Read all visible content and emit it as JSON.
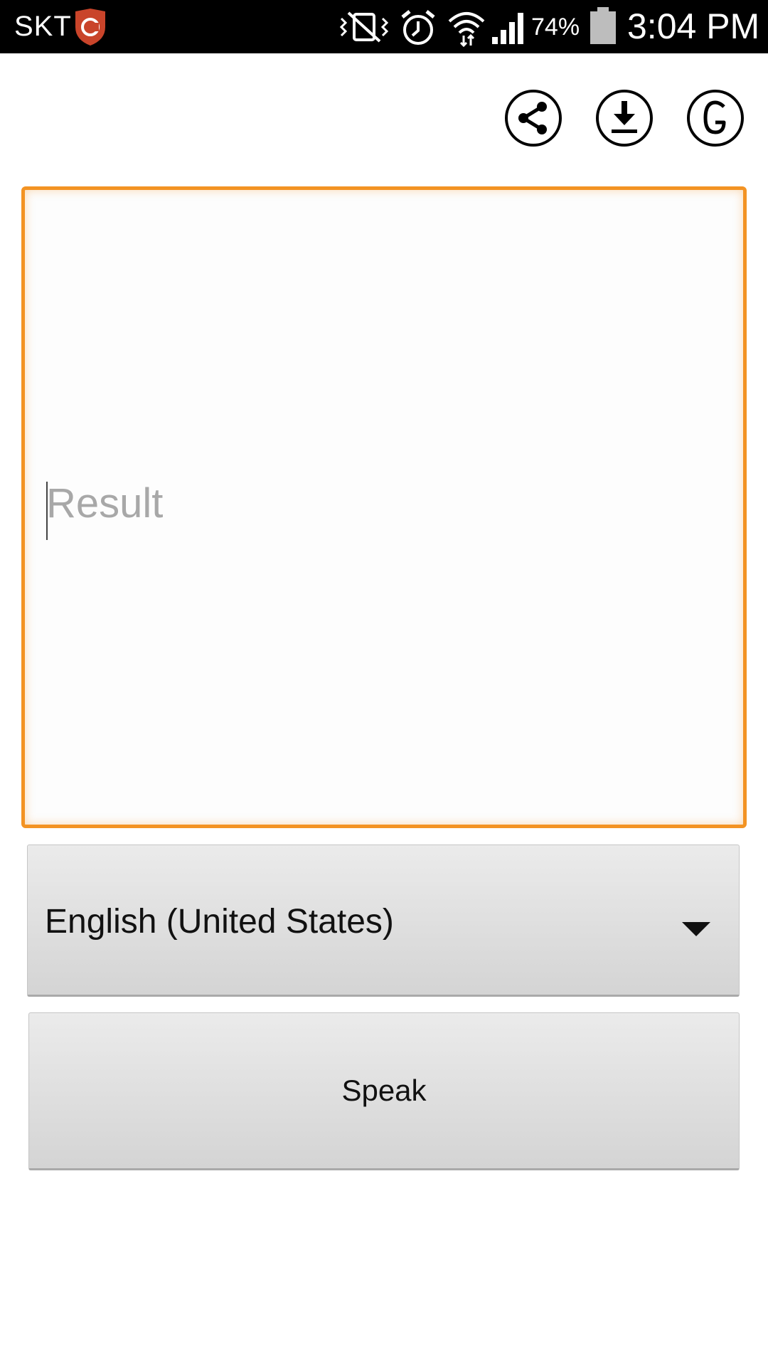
{
  "status_bar": {
    "carrier": "SKT",
    "battery_percent": "74%",
    "time": "3:04 PM",
    "icons": [
      "shield-icon",
      "vibrate-mute-icon",
      "alarm-icon",
      "wifi-icon",
      "signal-icon",
      "battery-icon"
    ]
  },
  "toolbar": {
    "icons": [
      "share-icon",
      "download-icon",
      "google-icon"
    ]
  },
  "result": {
    "placeholder": "Result",
    "value": ""
  },
  "language": {
    "selected": "English (United States)"
  },
  "speak_button": {
    "label": "Speak"
  },
  "colors": {
    "accent": "#f39323",
    "status_bar_bg": "#000000",
    "button_bg": "#dcdcdc"
  }
}
